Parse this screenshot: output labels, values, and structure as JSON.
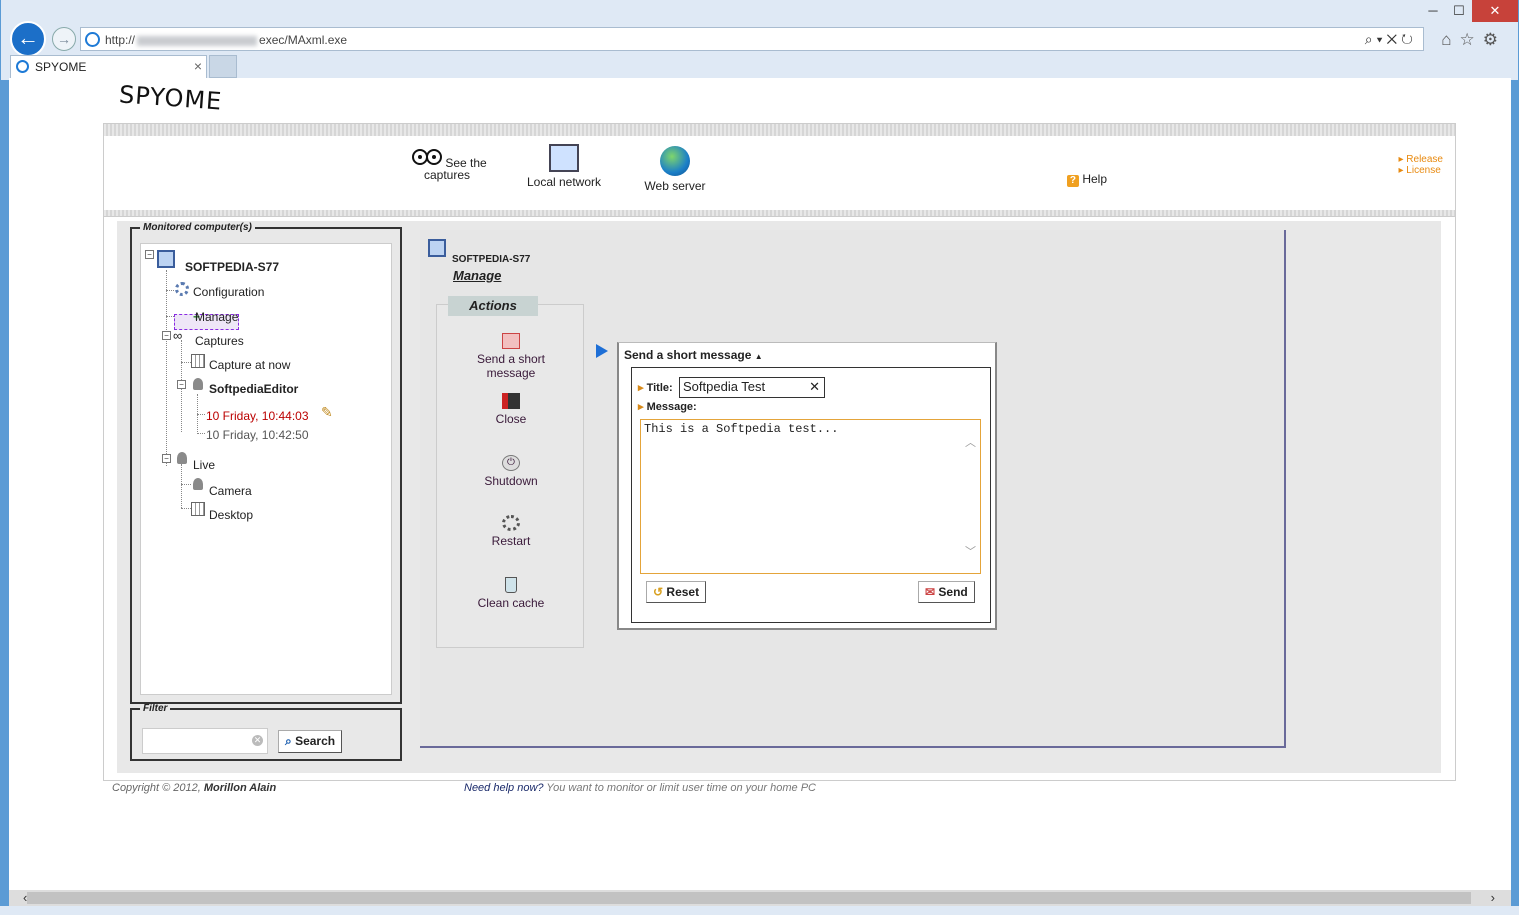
{
  "browser": {
    "url_prefix": "http://",
    "url_suffix": "exec/MAxml.exe",
    "tab_title": "SPYOME",
    "tab_close": "×"
  },
  "app": {
    "logo": "SPYOME",
    "nav": {
      "see_captures_line1": "See the",
      "see_captures_line2": "captures",
      "local_network": "Local network",
      "web_server": "Web server",
      "help": "Help"
    },
    "right_links": [
      "Release",
      "License"
    ],
    "monitored_legend": "Monitored computer(s)",
    "filter_legend": "Filter",
    "search_label": "Search",
    "tree": {
      "computer": "SOFTPEDIA-S77",
      "configuration": "Configuration",
      "manage": "Manage",
      "captures": "Captures",
      "capture_now": "Capture at now",
      "user": "SoftpediaEditor",
      "capture1": "10 Friday, 10:44:03",
      "capture2": "10 Friday, 10:42:50",
      "live": "Live",
      "camera": "Camera",
      "desktop": "Desktop"
    },
    "main": {
      "computer": "SOFTPEDIA-S77",
      "subtitle": "Manage",
      "actions_header": "Actions",
      "actions": {
        "send_msg_1": "Send a short",
        "send_msg_2": "message",
        "close": "Close",
        "shutdown": "Shutdown",
        "restart": "Restart",
        "clean_cache": "Clean cache"
      },
      "panel": {
        "title": "Send a short message",
        "title_label": "Title:",
        "title_value": "Softpedia Test",
        "message_label": "Message:",
        "message_value": "This is a Softpedia test...",
        "reset": "Reset",
        "send": "Send"
      }
    },
    "footer": {
      "copyright": "Copyright © 2012, ",
      "author": "Morillon Alain",
      "help_link": "Need help now?",
      "help_text": " You want to monitor or limit user time on your home PC"
    }
  },
  "colors": {
    "accent_blue": "#1c6fc8",
    "link_orange": "#e88a10",
    "capture_red": "#bb0000"
  }
}
